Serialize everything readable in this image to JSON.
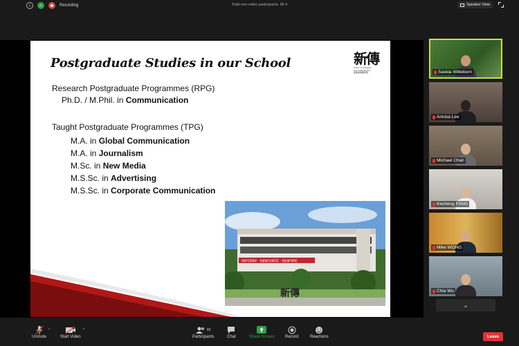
{
  "topbar": {
    "recording_label": "Recording",
    "participants_info": "Total non-video participants: 85",
    "speaker_view_label": "Speaker View"
  },
  "slide": {
    "title": "Postgraduate Studies in our School",
    "logo_chars": "新傳",
    "logo_sub_1": "School of Journalism",
    "logo_sub_2": "and Communication",
    "logo_sub_3": "新聞與傳播學院",
    "rpg_heading": "Research Postgraduate Programmes (RPG)",
    "rpg_item_prefix": "Ph.D. / M.Phil. in ",
    "rpg_item_bold": "Communication",
    "tpg_heading": "Taught Postgraduate Programmes (TPG)",
    "tpg_items": [
      {
        "prefix": "M.A. in ",
        "bold": "Global Communication"
      },
      {
        "prefix": "M.A. in ",
        "bold": "Journalism"
      },
      {
        "prefix": "M.Sc. in ",
        "bold": "New Media"
      },
      {
        "prefix": "M.S.Sc. in ",
        "bold": "Advertising"
      },
      {
        "prefix": "M.S.Sc. in ",
        "bold": "Corporate Communication"
      }
    ],
    "photo_banner": "INFORM · INNOVATE · INSPIRE",
    "photo_sign": "新傳"
  },
  "participants": [
    {
      "name": "Saskia Witteborn",
      "active": true
    },
    {
      "name": "Annisa Lee",
      "active": false
    },
    {
      "name": "Michael Chan",
      "active": false
    },
    {
      "name": "Kecheng FANG",
      "active": false
    },
    {
      "name": "Mike WONG",
      "active": false
    },
    {
      "name": "Chia Wu",
      "active": false
    }
  ],
  "toolbar": {
    "unmute_label": "Unmute",
    "start_video_label": "Start Video",
    "participants_label": "Participants",
    "participants_count": "92",
    "chat_label": "Chat",
    "share_label": "Share Screen",
    "record_label": "Record",
    "reactions_label": "Reactions",
    "leave_label": "Leave"
  },
  "colors": {
    "active_speaker_border": "#c7e03f",
    "share_green": "#2ea043",
    "leave_red": "#dd3333"
  }
}
